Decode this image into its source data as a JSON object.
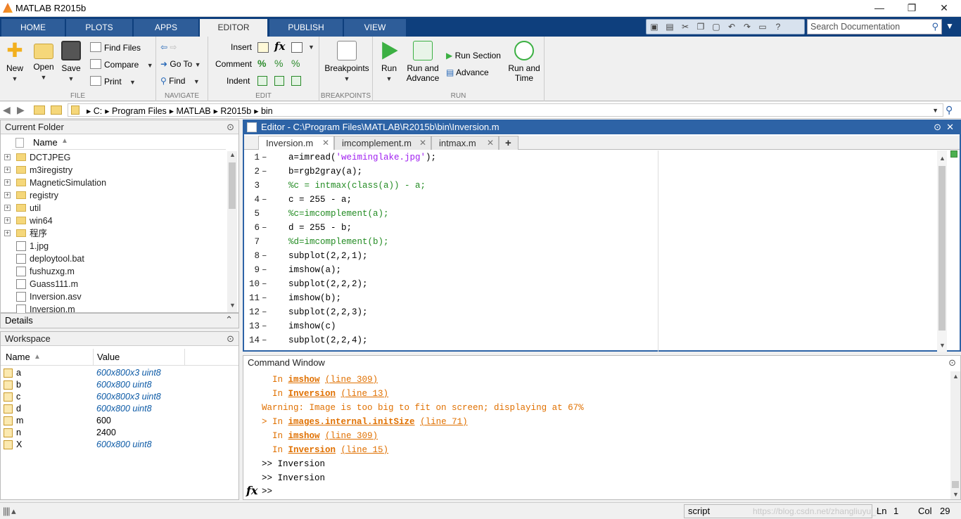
{
  "window": {
    "title": "MATLAB R2015b"
  },
  "ribbon_tabs": [
    "HOME",
    "PLOTS",
    "APPS",
    "EDITOR",
    "PUBLISH",
    "VIEW"
  ],
  "active_tab": "EDITOR",
  "search": {
    "placeholder": "Search Documentation"
  },
  "ribbon": {
    "file": {
      "label": "FILE",
      "new": "New",
      "open": "Open",
      "save": "Save",
      "find_files": "Find Files",
      "compare": "Compare",
      "print": "Print"
    },
    "navigate": {
      "label": "NAVIGATE",
      "go_to": "Go To",
      "find": "Find"
    },
    "edit": {
      "label": "EDIT",
      "insert": "Insert",
      "comment": "Comment",
      "indent": "Indent"
    },
    "breakpoints": {
      "label": "BREAKPOINTS",
      "breakpoints": "Breakpoints"
    },
    "run": {
      "label": "RUN",
      "run": "Run",
      "run_and_advance_1": "Run and",
      "run_and_advance_2": "Advance",
      "run_section": "Run Section",
      "advance": "Advance",
      "run_and_time_1": "Run and",
      "run_and_time_2": "Time"
    }
  },
  "address": {
    "parts": [
      "C:",
      "Program Files",
      "MATLAB",
      "R2015b",
      "bin"
    ]
  },
  "current_folder": {
    "title": "Current Folder",
    "column": "Name",
    "items": [
      {
        "name": "DCTJPEG",
        "type": "folder"
      },
      {
        "name": "m3iregistry",
        "type": "folder"
      },
      {
        "name": "MagneticSimulation",
        "type": "folder"
      },
      {
        "name": "registry",
        "type": "folder"
      },
      {
        "name": "util",
        "type": "folder"
      },
      {
        "name": "win64",
        "type": "folder"
      },
      {
        "name": "程序",
        "type": "folder"
      },
      {
        "name": "1.jpg",
        "type": "file"
      },
      {
        "name": "deploytool.bat",
        "type": "file"
      },
      {
        "name": "fushuzxg.m",
        "type": "file"
      },
      {
        "name": "Guass111.m",
        "type": "file"
      },
      {
        "name": "Inversion.asv",
        "type": "file"
      },
      {
        "name": "Inversion.m",
        "type": "file"
      }
    ]
  },
  "details": {
    "title": "Details"
  },
  "workspace": {
    "title": "Workspace",
    "columns": [
      "Name",
      "Value"
    ],
    "rows": [
      {
        "name": "a",
        "value": "600x800x3 uint8",
        "italic": true
      },
      {
        "name": "b",
        "value": "600x800 uint8",
        "italic": true
      },
      {
        "name": "c",
        "value": "600x800x3 uint8",
        "italic": true
      },
      {
        "name": "d",
        "value": "600x800 uint8",
        "italic": true
      },
      {
        "name": "m",
        "value": "600",
        "italic": false
      },
      {
        "name": "n",
        "value": "2400",
        "italic": false
      },
      {
        "name": "X",
        "value": "600x800 uint8",
        "italic": true
      }
    ]
  },
  "editor": {
    "title": "Editor - C:\\Program Files\\MATLAB\\R2015b\\bin\\Inversion.m",
    "tabs": [
      "Inversion.m",
      "imcomplement.m",
      "intmax.m"
    ],
    "new_tab": "+",
    "lines": [
      {
        "n": "1",
        "dash": "–",
        "parts": [
          {
            "t": "a=imread(",
            "c": ""
          },
          {
            "t": "'weiminglake.jpg'",
            "c": "st"
          },
          {
            "t": ");",
            "c": ""
          }
        ]
      },
      {
        "n": "2",
        "dash": "–",
        "parts": [
          {
            "t": "b=rgb2gray(a);",
            "c": ""
          }
        ]
      },
      {
        "n": "3",
        "dash": "",
        "parts": [
          {
            "t": "%c = intmax(class(a)) - a;",
            "c": "cm"
          }
        ]
      },
      {
        "n": "4",
        "dash": "–",
        "parts": [
          {
            "t": "c = 255 - a;",
            "c": ""
          }
        ]
      },
      {
        "n": "5",
        "dash": "",
        "parts": [
          {
            "t": "%c=imcomplement(a);",
            "c": "cm"
          }
        ]
      },
      {
        "n": "6",
        "dash": "–",
        "parts": [
          {
            "t": "d = 255 - b;",
            "c": ""
          }
        ]
      },
      {
        "n": "7",
        "dash": "",
        "parts": [
          {
            "t": "%d=imcomplement(b);",
            "c": "cm"
          }
        ]
      },
      {
        "n": "8",
        "dash": "–",
        "parts": [
          {
            "t": "subplot(2,2,1);",
            "c": ""
          }
        ]
      },
      {
        "n": "9",
        "dash": "–",
        "parts": [
          {
            "t": "imshow(a);",
            "c": ""
          }
        ]
      },
      {
        "n": "10",
        "dash": "–",
        "parts": [
          {
            "t": "subplot(2,2,2);",
            "c": ""
          }
        ]
      },
      {
        "n": "11",
        "dash": "–",
        "parts": [
          {
            "t": "imshow(b);",
            "c": ""
          }
        ]
      },
      {
        "n": "12",
        "dash": "–",
        "parts": [
          {
            "t": "subplot(2,2,3);",
            "c": ""
          }
        ]
      },
      {
        "n": "13",
        "dash": "–",
        "parts": [
          {
            "t": "imshow(c)",
            "c": ""
          }
        ]
      },
      {
        "n": "14",
        "dash": "–",
        "parts": [
          {
            "t": "subplot(2,2,4);",
            "c": ""
          }
        ]
      }
    ]
  },
  "command_window": {
    "title": "Command Window",
    "lines": [
      {
        "parts": [
          {
            "t": "  In ",
            "c": "warn"
          },
          {
            "t": "imshow",
            "c": "lk"
          },
          {
            "t": " ",
            "c": ""
          },
          {
            "t": "(line 309)",
            "c": "lk2"
          }
        ]
      },
      {
        "parts": [
          {
            "t": "  In ",
            "c": "warn"
          },
          {
            "t": "Inversion",
            "c": "lk"
          },
          {
            "t": " ",
            "c": ""
          },
          {
            "t": "(line 13)",
            "c": "lk2"
          }
        ]
      },
      {
        "parts": [
          {
            "t": "Warning: Image is too big to fit on screen; displaying at 67%",
            "c": "warn"
          }
        ]
      },
      {
        "parts": [
          {
            "t": "> In ",
            "c": "warn"
          },
          {
            "t": "images.internal.initSize",
            "c": "lk"
          },
          {
            "t": " ",
            "c": ""
          },
          {
            "t": "(line 71)",
            "c": "lk2"
          }
        ]
      },
      {
        "parts": [
          {
            "t": "  In ",
            "c": "warn"
          },
          {
            "t": "imshow",
            "c": "lk"
          },
          {
            "t": " ",
            "c": ""
          },
          {
            "t": "(line 309)",
            "c": "lk2"
          }
        ]
      },
      {
        "parts": [
          {
            "t": "  In ",
            "c": "warn"
          },
          {
            "t": "Inversion",
            "c": "lk"
          },
          {
            "t": " ",
            "c": ""
          },
          {
            "t": "(line 15)",
            "c": "lk2"
          }
        ]
      },
      {
        "parts": [
          {
            "t": ">> Inversion",
            "c": ""
          }
        ]
      },
      {
        "parts": [
          {
            "t": ">> Inversion",
            "c": ""
          }
        ]
      }
    ],
    "prompt": ">>",
    "fx": "fx"
  },
  "status": {
    "mode": "script",
    "ln_label": "Ln",
    "ln": "1",
    "col_label": "Col",
    "col": "29",
    "watermark": "https://blog.csdn.net/zhangliuyu_c"
  },
  "colors": {
    "accent": "#0e3f7d",
    "editor_border": "#2d63a6",
    "warning": "#e07000",
    "comment": "#228b22",
    "string": "#a020f0"
  }
}
